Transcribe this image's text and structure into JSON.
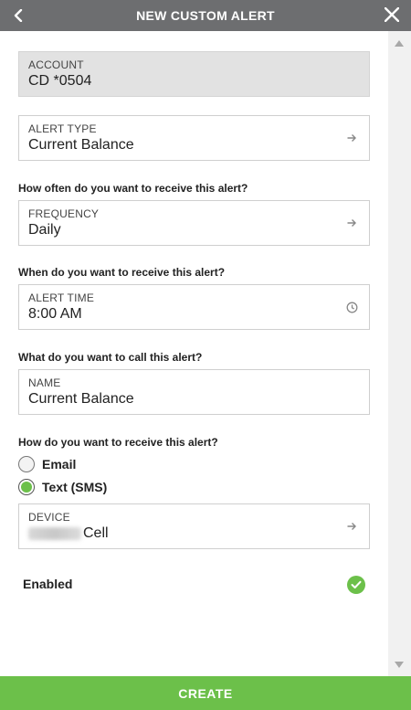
{
  "header": {
    "title": "NEW CUSTOM ALERT",
    "back_icon": "chevron-left-icon",
    "close_icon": "close-icon"
  },
  "account": {
    "label": "ACCOUNT",
    "value": "CD *0504"
  },
  "alert_type": {
    "label": "ALERT TYPE",
    "value": "Current Balance",
    "icon": "arrow-right-icon"
  },
  "frequency": {
    "question": "How often do you want to receive this alert?",
    "label": "FREQUENCY",
    "value": "Daily",
    "icon": "arrow-right-icon"
  },
  "alert_time": {
    "question": "When do you want to receive this alert?",
    "label": "ALERT TIME",
    "value": "8:00 AM",
    "icon": "clock-icon"
  },
  "name": {
    "question": "What do you want to call this alert?",
    "label": "NAME",
    "value": "Current Balance"
  },
  "delivery": {
    "question": "How do you want to receive this alert?",
    "options": [
      {
        "label": "Email",
        "checked": false
      },
      {
        "label": "Text (SMS)",
        "checked": true
      }
    ]
  },
  "device": {
    "label": "DEVICE",
    "value_suffix": "Cell",
    "icon": "arrow-right-icon"
  },
  "enabled": {
    "label": "Enabled",
    "state": true
  },
  "create_button": "CREATE",
  "colors": {
    "header": "#6d6e70",
    "accent": "#6cc04a",
    "disabled_field": "#e2e2e2"
  }
}
